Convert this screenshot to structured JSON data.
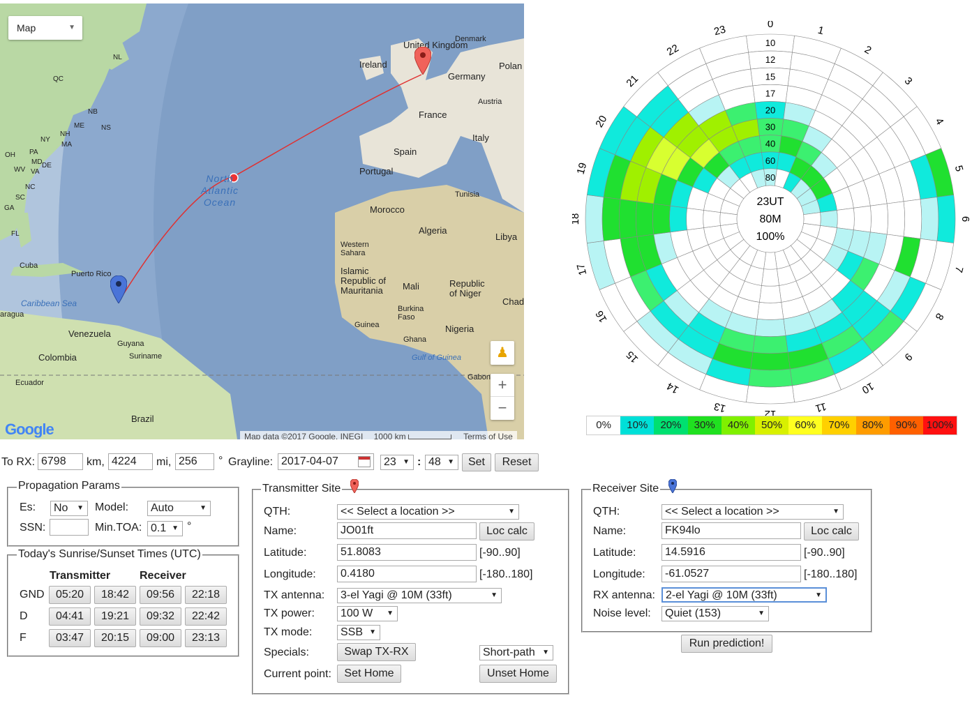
{
  "map": {
    "type_selector": "Map",
    "zoom_in": "+",
    "zoom_out": "−",
    "logo": "Google",
    "attribution": "Map data ©2017 Google, INEGI",
    "scale": "1000 km",
    "terms": "Terms of Use",
    "labels": {
      "united_kingdom": "United Kingdom",
      "ireland": "Ireland",
      "denmark": "Denmark",
      "germany": "Germany",
      "poland": "Polan",
      "austria": "Austria",
      "france": "France",
      "italy": "Italy",
      "spain": "Spain",
      "portugal": "Portugal",
      "tunisia": "Tunisia",
      "morocco": "Morocco",
      "algeria": "Algeria",
      "libya": "Libya",
      "western_sahara": "Western Sahara",
      "islamic_mauritania": "Islamic Republic of Mauritania",
      "mali": "Mali",
      "niger": "Republic of Niger",
      "chad": "Chad",
      "burkina": "Burkina Faso",
      "guinea": "Guinea",
      "nigeria": "Nigeria",
      "ghana": "Ghana",
      "gulf_guinea": "Gulf of Guinea",
      "gabon": "Gabon",
      "north_atlantic": "North Atlantic Ocean",
      "puerto_rico": "Puerto Rico",
      "cuba": "Cuba",
      "caribbean": "Caribbean Sea",
      "venezuela": "Venezuela",
      "guyana": "Guyana",
      "suriname": "Suriname",
      "colombia": "Colombia",
      "ecuador": "Ecuador",
      "brazil": "Brazil",
      "nicaragua": "aragua",
      "nl": "NL",
      "qc": "QC",
      "nb": "NB",
      "ns": "NS",
      "me": "ME",
      "nh": "NH",
      "ma": "MA",
      "ny": "NY",
      "pa": "PA",
      "oh": "OH",
      "wv": "WV",
      "va": "VA",
      "de": "DE",
      "md": "MD",
      "nc": "NC",
      "sc": "SC",
      "ga": "GA",
      "fl": "FL"
    }
  },
  "polar": {
    "center": [
      "23UT",
      "80M",
      "100%"
    ],
    "hours": [
      "0",
      "1",
      "2",
      "3",
      "4",
      "5",
      "6",
      "7",
      "8",
      "9",
      "10",
      "11",
      "12",
      "13",
      "14",
      "15",
      "16",
      "17",
      "18",
      "19",
      "20",
      "21",
      "22",
      "23"
    ],
    "bands": [
      "10",
      "12",
      "15",
      "17",
      "20",
      "30",
      "40",
      "60",
      "80"
    ],
    "colors": {
      "0": "#ffffff",
      "10": "#00e0d8",
      "20": "#00e070",
      "30": "#20e020",
      "40": "#80f000",
      "50": "#d8f000",
      "60": "#ffff20",
      "70": "#ffd000",
      "80": "#ff9c00",
      "90": "#ff6000",
      "100": "#ff1010",
      "pale": "#b8f4f4",
      "cyan": "#10eadc",
      "lgreen": "#3cf070",
      "mgreen": "#20e030",
      "lime": "#a0f000",
      "yl": "#d8ff30"
    },
    "levels": {
      "h0": {
        "20": "cyan",
        "30": "lgreen",
        "40": "lgreen",
        "60": "cyan",
        "80": "pale"
      },
      "h1": {
        "20": "pale",
        "30": "lgreen",
        "40": "mgreen",
        "60": "cyan"
      },
      "h2": {
        "30": "pale",
        "40": "lgreen",
        "60": "mgreen",
        "80": "cyan"
      },
      "h3": {
        "40": "pale",
        "60": "mgreen",
        "80": "pale"
      },
      "h4": {
        "60": "mgreen",
        "80": "pale"
      },
      "h5": {
        "60": "cyan",
        "80": "pale",
        "10": "mgreen",
        "12": "cyan"
      },
      "h6": {
        "60": "pale",
        "10": "cyan",
        "12": "pale"
      },
      "h7": {
        "30": "pale",
        "40": "pale",
        "20": "pale",
        "15": "mgreen"
      },
      "h8": {
        "20": "lgreen",
        "30": "cyan",
        "40": "pale",
        "15": "pale",
        "12": "cyan"
      },
      "h9": {
        "12": "lgreen",
        "15": "cyan",
        "17": "cyan",
        "20": "cyan"
      },
      "h10": {
        "12": "cyan",
        "15": "lgreen",
        "17": "cyan",
        "20": "pale"
      },
      "h11": {
        "12": "lgreen",
        "15": "mgreen",
        "17": "cyan",
        "20": "pale"
      },
      "h12": {
        "12": "lgreen",
        "15": "mgreen",
        "17": "lgreen",
        "20": "pale"
      },
      "h13": {
        "12": "cyan",
        "15": "mgreen",
        "17": "lgreen",
        "20": "pale"
      },
      "h14": {
        "12": "pale",
        "15": "cyan",
        "17": "cyan",
        "20": "pale"
      },
      "h15": {
        "12": "pale",
        "15": "cyan",
        "17": "pale"
      },
      "h16": {
        "15": "lgreen",
        "17": "cyan"
      },
      "h17": {
        "10": "pale",
        "15": "mgreen",
        "17": "mgreen",
        "20": "pale"
      },
      "h18": {
        "10": "pale",
        "12": "mgreen",
        "15": "mgreen",
        "17": "mgreen",
        "20": "mgreen",
        "30": "cyan"
      },
      "h19": {
        "10": "cyan",
        "12": "mgreen",
        "15": "lime",
        "17": "lime",
        "20": "mgreen",
        "30": "cyan"
      },
      "h20": {
        "10": "cyan",
        "12": "cyan",
        "15": "lime",
        "17": "yl",
        "20": "yl",
        "30": "mgreen",
        "40": "cyan"
      },
      "h21": {
        "12": "cyan",
        "15": "cyan",
        "17": "lime",
        "20": "lime",
        "30": "yl",
        "40": "mgreen",
        "60": "pale"
      },
      "h22": {
        "17": "pale",
        "20": "lime",
        "30": "lime",
        "40": "lgreen",
        "60": "cyan"
      },
      "h23": {
        "20": "lgreen",
        "30": "lime",
        "40": "lgreen",
        "60": "cyan",
        "80": "pale"
      }
    },
    "legend": [
      "0%",
      "10%",
      "20%",
      "30%",
      "40%",
      "50%",
      "60%",
      "70%",
      "80%",
      "90%",
      "100%"
    ]
  },
  "distance": {
    "to_rx_label": "To RX:",
    "km_value": "6798",
    "km_unit": "km,",
    "mi_value": "4224",
    "mi_unit": "mi,",
    "deg_value": "256",
    "deg_unit": "°",
    "grayline_label": "Grayline:",
    "date": "2017-04-07",
    "hour": "23",
    "colon": ":",
    "minute": "48",
    "set": "Set",
    "reset": "Reset"
  },
  "prop": {
    "title": "Propagation Params",
    "es_label": "Es:",
    "es_value": "No",
    "model_label": "Model:",
    "model_value": "Auto",
    "ssn_label": "SSN:",
    "ssn_value": "",
    "toa_label": "Min.TOA:",
    "toa_value": "0.1",
    "toa_unit": "°"
  },
  "sun": {
    "title": "Today's Sunrise/Sunset Times (UTC)",
    "tx_header": "Transmitter",
    "rx_header": "Receiver",
    "rows": [
      {
        "label": "GND",
        "tx_rise": "05:20",
        "tx_set": "18:42",
        "rx_rise": "09:56",
        "rx_set": "22:18"
      },
      {
        "label": "D",
        "tx_rise": "04:41",
        "tx_set": "19:21",
        "rx_rise": "09:32",
        "rx_set": "22:42"
      },
      {
        "label": "F",
        "tx_rise": "03:47",
        "tx_set": "20:15",
        "rx_rise": "09:00",
        "rx_set": "23:13"
      }
    ]
  },
  "tx": {
    "title": "Transmitter Site",
    "pin_color": "#f0625a",
    "qth_label": "QTH:",
    "qth_value": "<< Select a location >>",
    "name_label": "Name:",
    "name_value": "JO01ft",
    "loc_calc": "Loc calc",
    "lat_label": "Latitude:",
    "lat_value": "51.8083",
    "lat_range": "[-90..90]",
    "lon_label": "Longitude:",
    "lon_value": "0.4180",
    "lon_range": "[-180..180]",
    "ant_label": "TX antenna:",
    "ant_value": "3-el Yagi @ 10M (33ft)",
    "power_label": "TX power:",
    "power_value": "100 W",
    "mode_label": "TX mode:",
    "mode_value": "SSB",
    "specials_label": "Specials:",
    "swap": "Swap TX-RX",
    "path_value": "Short-path",
    "current_label": "Current point:",
    "set_home": "Set Home",
    "unset_home": "Unset Home"
  },
  "rx": {
    "title": "Receiver Site",
    "pin_color": "#4a74d8",
    "qth_label": "QTH:",
    "qth_value": "<< Select a location >>",
    "name_label": "Name:",
    "name_value": "FK94lo",
    "loc_calc": "Loc calc",
    "lat_label": "Latitude:",
    "lat_value": "14.5916",
    "lat_range": "[-90..90]",
    "lon_label": "Longitude:",
    "lon_value": "-61.0527",
    "lon_range": "[-180..180]",
    "ant_label": "RX antenna:",
    "ant_value": "2-el Yagi @ 10M (33ft)",
    "noise_label": "Noise level:",
    "noise_value": "Quiet (153)",
    "run": "Run prediction!"
  }
}
